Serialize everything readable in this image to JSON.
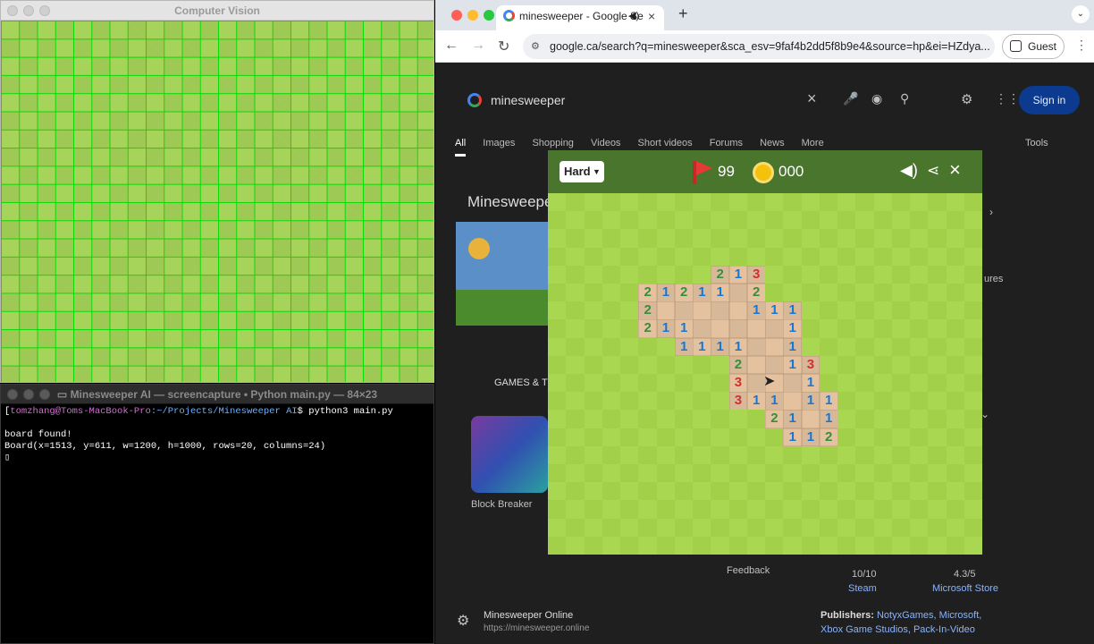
{
  "cv_window": {
    "title": "Computer Vision"
  },
  "terminal": {
    "title": "Minesweeper AI — screencapture • Python main.py — 84×23",
    "prompt_user": "tomzhang@Toms-MacBook-Pro",
    "prompt_path": ":~/Projects/Minesweeper AI",
    "prompt_cmd": "$ python3 main.py",
    "line_blank": "",
    "line_found": "board found!",
    "line_board": "Board(x=1513, y=611, w=1200, h=1000, rows=20, columns=24)"
  },
  "browser": {
    "tab_title": "minesweeper - Google Se",
    "url": "google.ca/search?q=minesweeper&sca_esv=9faf4b2dd5f8b9e4&source=hp&ei=HZdya...",
    "guest_label": "Guest",
    "search_query": "minesweeper",
    "sign_in": "Sign in",
    "search_tabs": [
      "All",
      "Images",
      "Shopping",
      "Videos",
      "Short videos",
      "Forums",
      "News",
      "More"
    ],
    "tools": "Tools",
    "kp_title": "Minesweepe",
    "games_label": "GAMES & T",
    "block_breaker": "Block Breaker",
    "feedback": "Feedback",
    "rating1_score": "10/10",
    "rating1_source": "Steam",
    "rating2_score": "4.3/5",
    "rating2_source": "Microsoft Store",
    "site_name": "Minesweeper Online",
    "site_url": "https://minesweeper.online",
    "publishers_label": "Publishers:",
    "publishers_value": "NotyxGames, Microsoft, Xbox Game Studios, Pack-In-Video",
    "side_text": "ures"
  },
  "game": {
    "difficulty": "Hard",
    "flags": "99",
    "timer": "000",
    "colors": {
      "header": "#4a752c",
      "light": "#aad751",
      "dark": "#a2d149",
      "revealed_light": "#e5c29f",
      "revealed_dark": "#d7b899",
      "n1": "#1976d2",
      "n2": "#388e3c",
      "n3": "#d32f2f"
    },
    "numbers": [
      {
        "r": 4,
        "c": 9,
        "v": "2"
      },
      {
        "r": 4,
        "c": 10,
        "v": "1"
      },
      {
        "r": 4,
        "c": 11,
        "v": "3"
      },
      {
        "r": 5,
        "c": 5,
        "v": "2"
      },
      {
        "r": 5,
        "c": 6,
        "v": "1"
      },
      {
        "r": 5,
        "c": 7,
        "v": "2"
      },
      {
        "r": 5,
        "c": 8,
        "v": "1"
      },
      {
        "r": 5,
        "c": 9,
        "v": "1"
      },
      {
        "r": 5,
        "c": 11,
        "v": "2"
      },
      {
        "r": 6,
        "c": 5,
        "v": "2"
      },
      {
        "r": 6,
        "c": 11,
        "v": "1"
      },
      {
        "r": 6,
        "c": 12,
        "v": "1"
      },
      {
        "r": 6,
        "c": 13,
        "v": "1"
      },
      {
        "r": 7,
        "c": 5,
        "v": "2"
      },
      {
        "r": 7,
        "c": 6,
        "v": "1"
      },
      {
        "r": 7,
        "c": 7,
        "v": "1"
      },
      {
        "r": 7,
        "c": 13,
        "v": "1"
      },
      {
        "r": 8,
        "c": 7,
        "v": "1"
      },
      {
        "r": 8,
        "c": 8,
        "v": "1"
      },
      {
        "r": 8,
        "c": 9,
        "v": "1"
      },
      {
        "r": 8,
        "c": 10,
        "v": "1"
      },
      {
        "r": 8,
        "c": 13,
        "v": "1"
      },
      {
        "r": 9,
        "c": 10,
        "v": "2"
      },
      {
        "r": 9,
        "c": 13,
        "v": "1"
      },
      {
        "r": 9,
        "c": 14,
        "v": "3"
      },
      {
        "r": 10,
        "c": 10,
        "v": "3"
      },
      {
        "r": 10,
        "c": 14,
        "v": "1"
      },
      {
        "r": 11,
        "c": 10,
        "v": "3"
      },
      {
        "r": 11,
        "c": 11,
        "v": "1"
      },
      {
        "r": 11,
        "c": 12,
        "v": "1"
      },
      {
        "r": 11,
        "c": 14,
        "v": "1"
      },
      {
        "r": 11,
        "c": 15,
        "v": "1"
      },
      {
        "r": 12,
        "c": 12,
        "v": "2"
      },
      {
        "r": 12,
        "c": 13,
        "v": "1"
      },
      {
        "r": 12,
        "c": 15,
        "v": "1"
      },
      {
        "r": 13,
        "c": 13,
        "v": "1"
      },
      {
        "r": 13,
        "c": 14,
        "v": "1"
      },
      {
        "r": 13,
        "c": 15,
        "v": "2"
      }
    ],
    "blanks": [
      {
        "r": 5,
        "c": 10
      },
      {
        "r": 6,
        "c": 6
      },
      {
        "r": 6,
        "c": 7
      },
      {
        "r": 6,
        "c": 8
      },
      {
        "r": 6,
        "c": 9
      },
      {
        "r": 6,
        "c": 10
      },
      {
        "r": 7,
        "c": 8
      },
      {
        "r": 7,
        "c": 9
      },
      {
        "r": 7,
        "c": 10
      },
      {
        "r": 7,
        "c": 11
      },
      {
        "r": 7,
        "c": 12
      },
      {
        "r": 8,
        "c": 11
      },
      {
        "r": 8,
        "c": 12
      },
      {
        "r": 9,
        "c": 11
      },
      {
        "r": 9,
        "c": 12
      },
      {
        "r": 10,
        "c": 11
      },
      {
        "r": 10,
        "c": 12
      },
      {
        "r": 10,
        "c": 13
      },
      {
        "r": 11,
        "c": 13
      },
      {
        "r": 12,
        "c": 14
      }
    ]
  }
}
